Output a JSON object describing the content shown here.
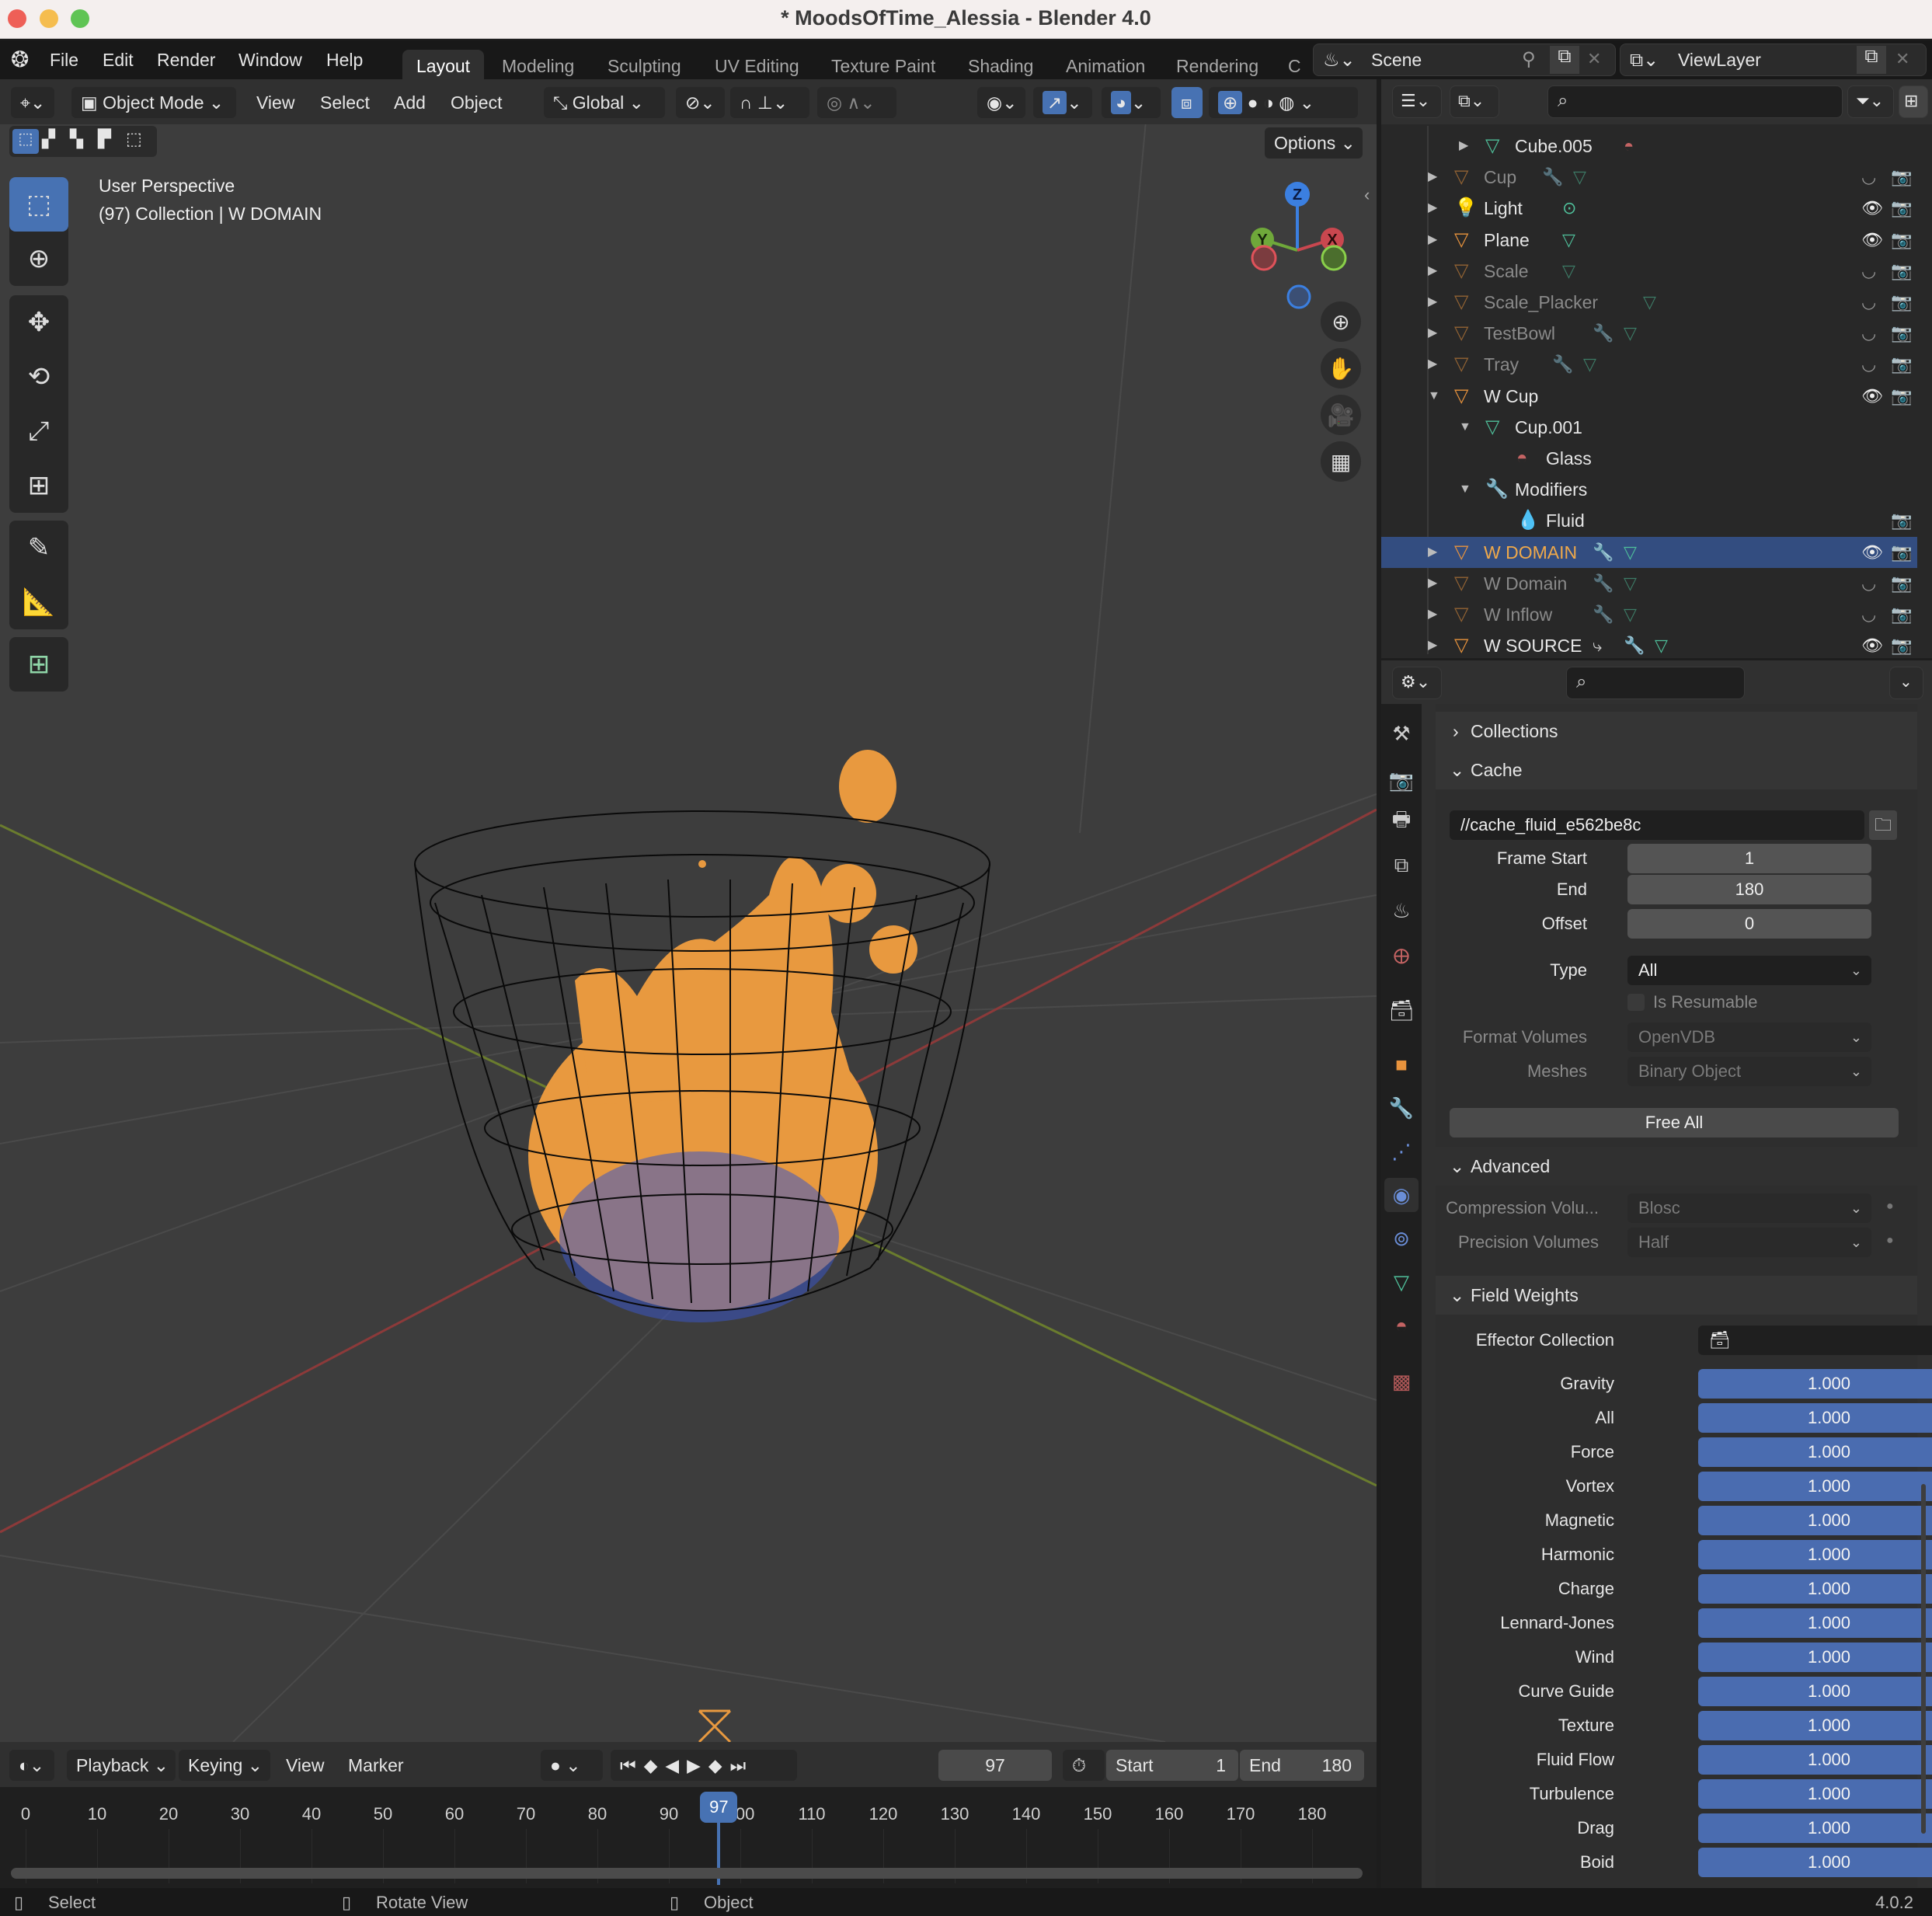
{
  "window": {
    "title": "* MoodsOfTime_Alessia - Blender 4.0"
  },
  "menubar": {
    "items": [
      "File",
      "Edit",
      "Render",
      "Window",
      "Help"
    ],
    "workspaces": [
      "Layout",
      "Modeling",
      "Sculpting",
      "UV Editing",
      "Texture Paint",
      "Shading",
      "Animation",
      "Rendering",
      "C"
    ],
    "active_workspace": "Layout",
    "scene": "Scene",
    "view_layer": "ViewLayer"
  },
  "viewport": {
    "mode": "Object Mode",
    "menus": [
      "View",
      "Select",
      "Add",
      "Object"
    ],
    "transform_orientation": "Global",
    "options_label": "Options",
    "overlay_line1": "User Perspective",
    "overlay_line2": "(97) Collection | W DOMAIN",
    "gizmo_axes": [
      "Z",
      "Y",
      "X"
    ]
  },
  "outliner": {
    "rows": [
      {
        "name": "Cube.005",
        "type": "mesh-data",
        "depth": 2,
        "dim": false,
        "expand": "collapsed",
        "extras": [
          "material"
        ],
        "visible": null
      },
      {
        "name": "Cup",
        "type": "object",
        "depth": 1,
        "dim": true,
        "expand": "collapsed",
        "extras": [
          "modifier",
          "mesh"
        ],
        "visible": false
      },
      {
        "name": "Light",
        "type": "light",
        "depth": 1,
        "dim": false,
        "expand": "collapsed",
        "extras": [
          "light-data"
        ],
        "visible": true
      },
      {
        "name": "Plane",
        "type": "object",
        "depth": 1,
        "dim": false,
        "expand": "collapsed",
        "extras": [
          "mesh"
        ],
        "visible": true
      },
      {
        "name": "Scale",
        "type": "object",
        "depth": 1,
        "dim": true,
        "expand": "collapsed",
        "extras": [
          "mesh"
        ],
        "visible": false
      },
      {
        "name": "Scale_Placker",
        "type": "object",
        "depth": 1,
        "dim": true,
        "expand": "collapsed",
        "extras": [
          "mesh"
        ],
        "visible": false
      },
      {
        "name": "TestBowl",
        "type": "object",
        "depth": 1,
        "dim": true,
        "expand": "collapsed",
        "extras": [
          "modifier",
          "mesh"
        ],
        "visible": false
      },
      {
        "name": "Tray",
        "type": "object",
        "depth": 1,
        "dim": true,
        "expand": "collapsed",
        "extras": [
          "modifier",
          "mesh"
        ],
        "visible": false
      },
      {
        "name": "W Cup",
        "type": "object",
        "depth": 1,
        "dim": false,
        "expand": "expanded",
        "extras": [],
        "visible": true
      },
      {
        "name": "Cup.001",
        "type": "mesh-data",
        "depth": 2,
        "dim": false,
        "expand": "expanded",
        "extras": [],
        "visible": null
      },
      {
        "name": "Glass",
        "type": "material",
        "depth": 3,
        "dim": false,
        "expand": "none",
        "extras": [],
        "visible": null
      },
      {
        "name": "Modifiers",
        "type": "modifiers",
        "depth": 2,
        "dim": false,
        "expand": "expanded",
        "extras": [],
        "visible": null
      },
      {
        "name": "Fluid",
        "type": "fluid",
        "depth": 3,
        "dim": false,
        "expand": "none",
        "extras": [],
        "visible": "render-only"
      },
      {
        "name": "W DOMAIN",
        "type": "object",
        "depth": 1,
        "dim": false,
        "expand": "collapsed",
        "extras": [
          "modifier",
          "mesh"
        ],
        "visible": true,
        "selected": true
      },
      {
        "name": "W Domain",
        "type": "object",
        "depth": 1,
        "dim": true,
        "expand": "collapsed",
        "extras": [
          "modifier",
          "mesh"
        ],
        "visible": false
      },
      {
        "name": "W Inflow",
        "type": "object",
        "depth": 1,
        "dim": true,
        "expand": "collapsed",
        "extras": [
          "modifier",
          "mesh"
        ],
        "visible": false
      },
      {
        "name": "W SOURCE",
        "type": "object",
        "depth": 1,
        "dim": false,
        "expand": "collapsed",
        "extras": [
          "constraint",
          "modifier",
          "mesh"
        ],
        "visible": true
      }
    ]
  },
  "properties": {
    "collections_label": "Collections",
    "cache": {
      "label": "Cache",
      "path": "//cache_fluid_e562be8c",
      "frame_start_label": "Frame Start",
      "frame_start": "1",
      "end_label": "End",
      "end": "180",
      "offset_label": "Offset",
      "offset": "0",
      "type_label": "Type",
      "type": "All",
      "is_resumable_label": "Is Resumable",
      "format_volumes_label": "Format Volumes",
      "format_volumes": "OpenVDB",
      "meshes_label": "Meshes",
      "meshes": "Binary Object",
      "free_all_label": "Free All"
    },
    "advanced": {
      "label": "Advanced",
      "compression_label": "Compression Volu...",
      "compression": "Blosc",
      "precision_label": "Precision Volumes",
      "precision": "Half"
    },
    "field_weights": {
      "label": "Field Weights",
      "effector_collection_label": "Effector Collection",
      "weights": [
        {
          "label": "Gravity",
          "value": "1.000"
        },
        {
          "label": "All",
          "value": "1.000"
        },
        {
          "label": "Force",
          "value": "1.000"
        },
        {
          "label": "Vortex",
          "value": "1.000"
        },
        {
          "label": "Magnetic",
          "value": "1.000"
        },
        {
          "label": "Harmonic",
          "value": "1.000"
        },
        {
          "label": "Charge",
          "value": "1.000"
        },
        {
          "label": "Lennard-Jones",
          "value": "1.000"
        },
        {
          "label": "Wind",
          "value": "1.000"
        },
        {
          "label": "Curve Guide",
          "value": "1.000"
        },
        {
          "label": "Texture",
          "value": "1.000"
        },
        {
          "label": "Fluid Flow",
          "value": "1.000"
        },
        {
          "label": "Turbulence",
          "value": "1.000"
        },
        {
          "label": "Drag",
          "value": "1.000"
        },
        {
          "label": "Boid",
          "value": "1.000"
        }
      ]
    }
  },
  "timeline": {
    "menus": [
      "Playback",
      "Keying",
      "View",
      "Marker"
    ],
    "current_frame": "97",
    "start_label": "Start",
    "start": "1",
    "end_label": "End",
    "end": "180",
    "ticks": [
      "0",
      "10",
      "20",
      "30",
      "40",
      "50",
      "60",
      "70",
      "80",
      "90",
      "100",
      "110",
      "120",
      "130",
      "140",
      "150",
      "160",
      "170",
      "180"
    ]
  },
  "statusbar": {
    "items": [
      "Select",
      "Rotate View",
      "Object"
    ],
    "version": "4.0.2"
  },
  "colors": {
    "accent": "#4772b3",
    "selected_row": "#334d80",
    "object_orange": "#e8933d",
    "mesh_green": "#4fbf9a",
    "modifier_blue": "#6a8ed8"
  }
}
